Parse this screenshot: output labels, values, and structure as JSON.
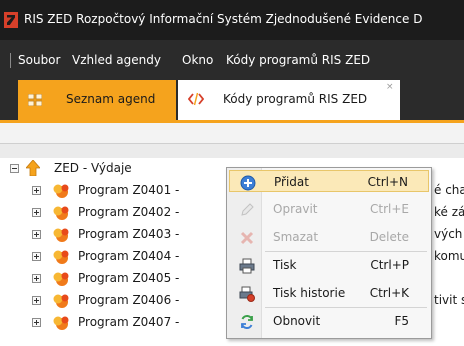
{
  "window": {
    "title": "RIS ZED Rozpočtový Informační Systém Zjednodušené Evidence D"
  },
  "menubar": {
    "items": [
      "Soubor",
      "Vzhled agendy",
      "Okno",
      "Kódy programů RIS ZED"
    ]
  },
  "tabs": [
    {
      "label": "Seznam agend",
      "icon": "grid-icon"
    },
    {
      "label": "Kódy programů RIS ZED",
      "icon": "code-icon",
      "close": "×"
    }
  ],
  "tree": {
    "root": "ZED - Výdaje",
    "nodes": [
      "Program Z0401 -",
      "Program Z0402 -",
      "Program Z0403 -",
      "Program Z0404 -",
      "Program Z0405 -",
      "Program Z0406 -",
      "Program Z0407 -"
    ],
    "truncated": [
      "é char",
      "ké zá",
      "vých",
      "komu",
      "",
      "tivit s",
      ""
    ]
  },
  "context_menu": {
    "items": [
      {
        "label": "Přidat",
        "shortcut": "Ctrl+N",
        "state": "highlighted",
        "icon": "add-icon"
      },
      {
        "label": "Opravit",
        "shortcut": "Ctrl+E",
        "state": "disabled",
        "icon": "edit-icon"
      },
      {
        "label": "Smazat",
        "shortcut": "Delete",
        "state": "disabled",
        "icon": "delete-icon"
      },
      {
        "label": "Tisk",
        "shortcut": "Ctrl+P",
        "state": "enabled",
        "icon": "print-icon"
      },
      {
        "label": "Tisk historie",
        "shortcut": "Ctrl+K",
        "state": "enabled",
        "icon": "print-history-icon"
      },
      {
        "label": "Obnovit",
        "shortcut": "F5",
        "state": "enabled",
        "icon": "refresh-icon"
      }
    ]
  },
  "colors": {
    "accent": "#f5a31d",
    "titlebar": "#1c1c1c",
    "menubar": "#2b2b2b",
    "highlight": "#fbe9b8"
  }
}
